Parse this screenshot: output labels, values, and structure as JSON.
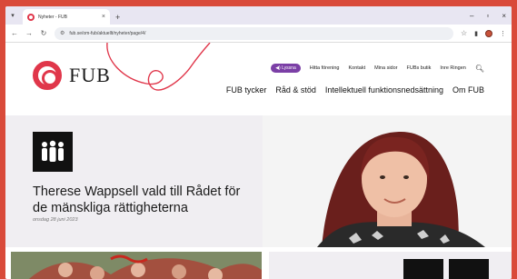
{
  "browser": {
    "tab_title": "Nyheter - FUB",
    "tab_close": "×",
    "new_tab": "+",
    "url": "fub.se/om-fub/aktuellt/nyheter/page/4/",
    "window_controls": [
      "–",
      "▫",
      "×"
    ]
  },
  "site": {
    "logo_text": "FUB",
    "util_nav": {
      "listen_label": "◀) Lyssna",
      "links": [
        "Hitta förening",
        "Kontakt",
        "Mina sidor",
        "FUBs butik",
        "Inre Ringen"
      ]
    },
    "main_nav": [
      "FUB tycker",
      "Råd & stöd",
      "Intellektuell funktionsnedsättning",
      "Om FUB"
    ]
  },
  "hero": {
    "headline": "Therese Wappsell vald till Rådet för de mänskliga rättigheterna",
    "date": "onsdag 28 juni 2023"
  },
  "colors": {
    "brand_red": "#e0364a",
    "accent_purple": "#7b3fa6",
    "hero_bg": "#f0eef2"
  }
}
